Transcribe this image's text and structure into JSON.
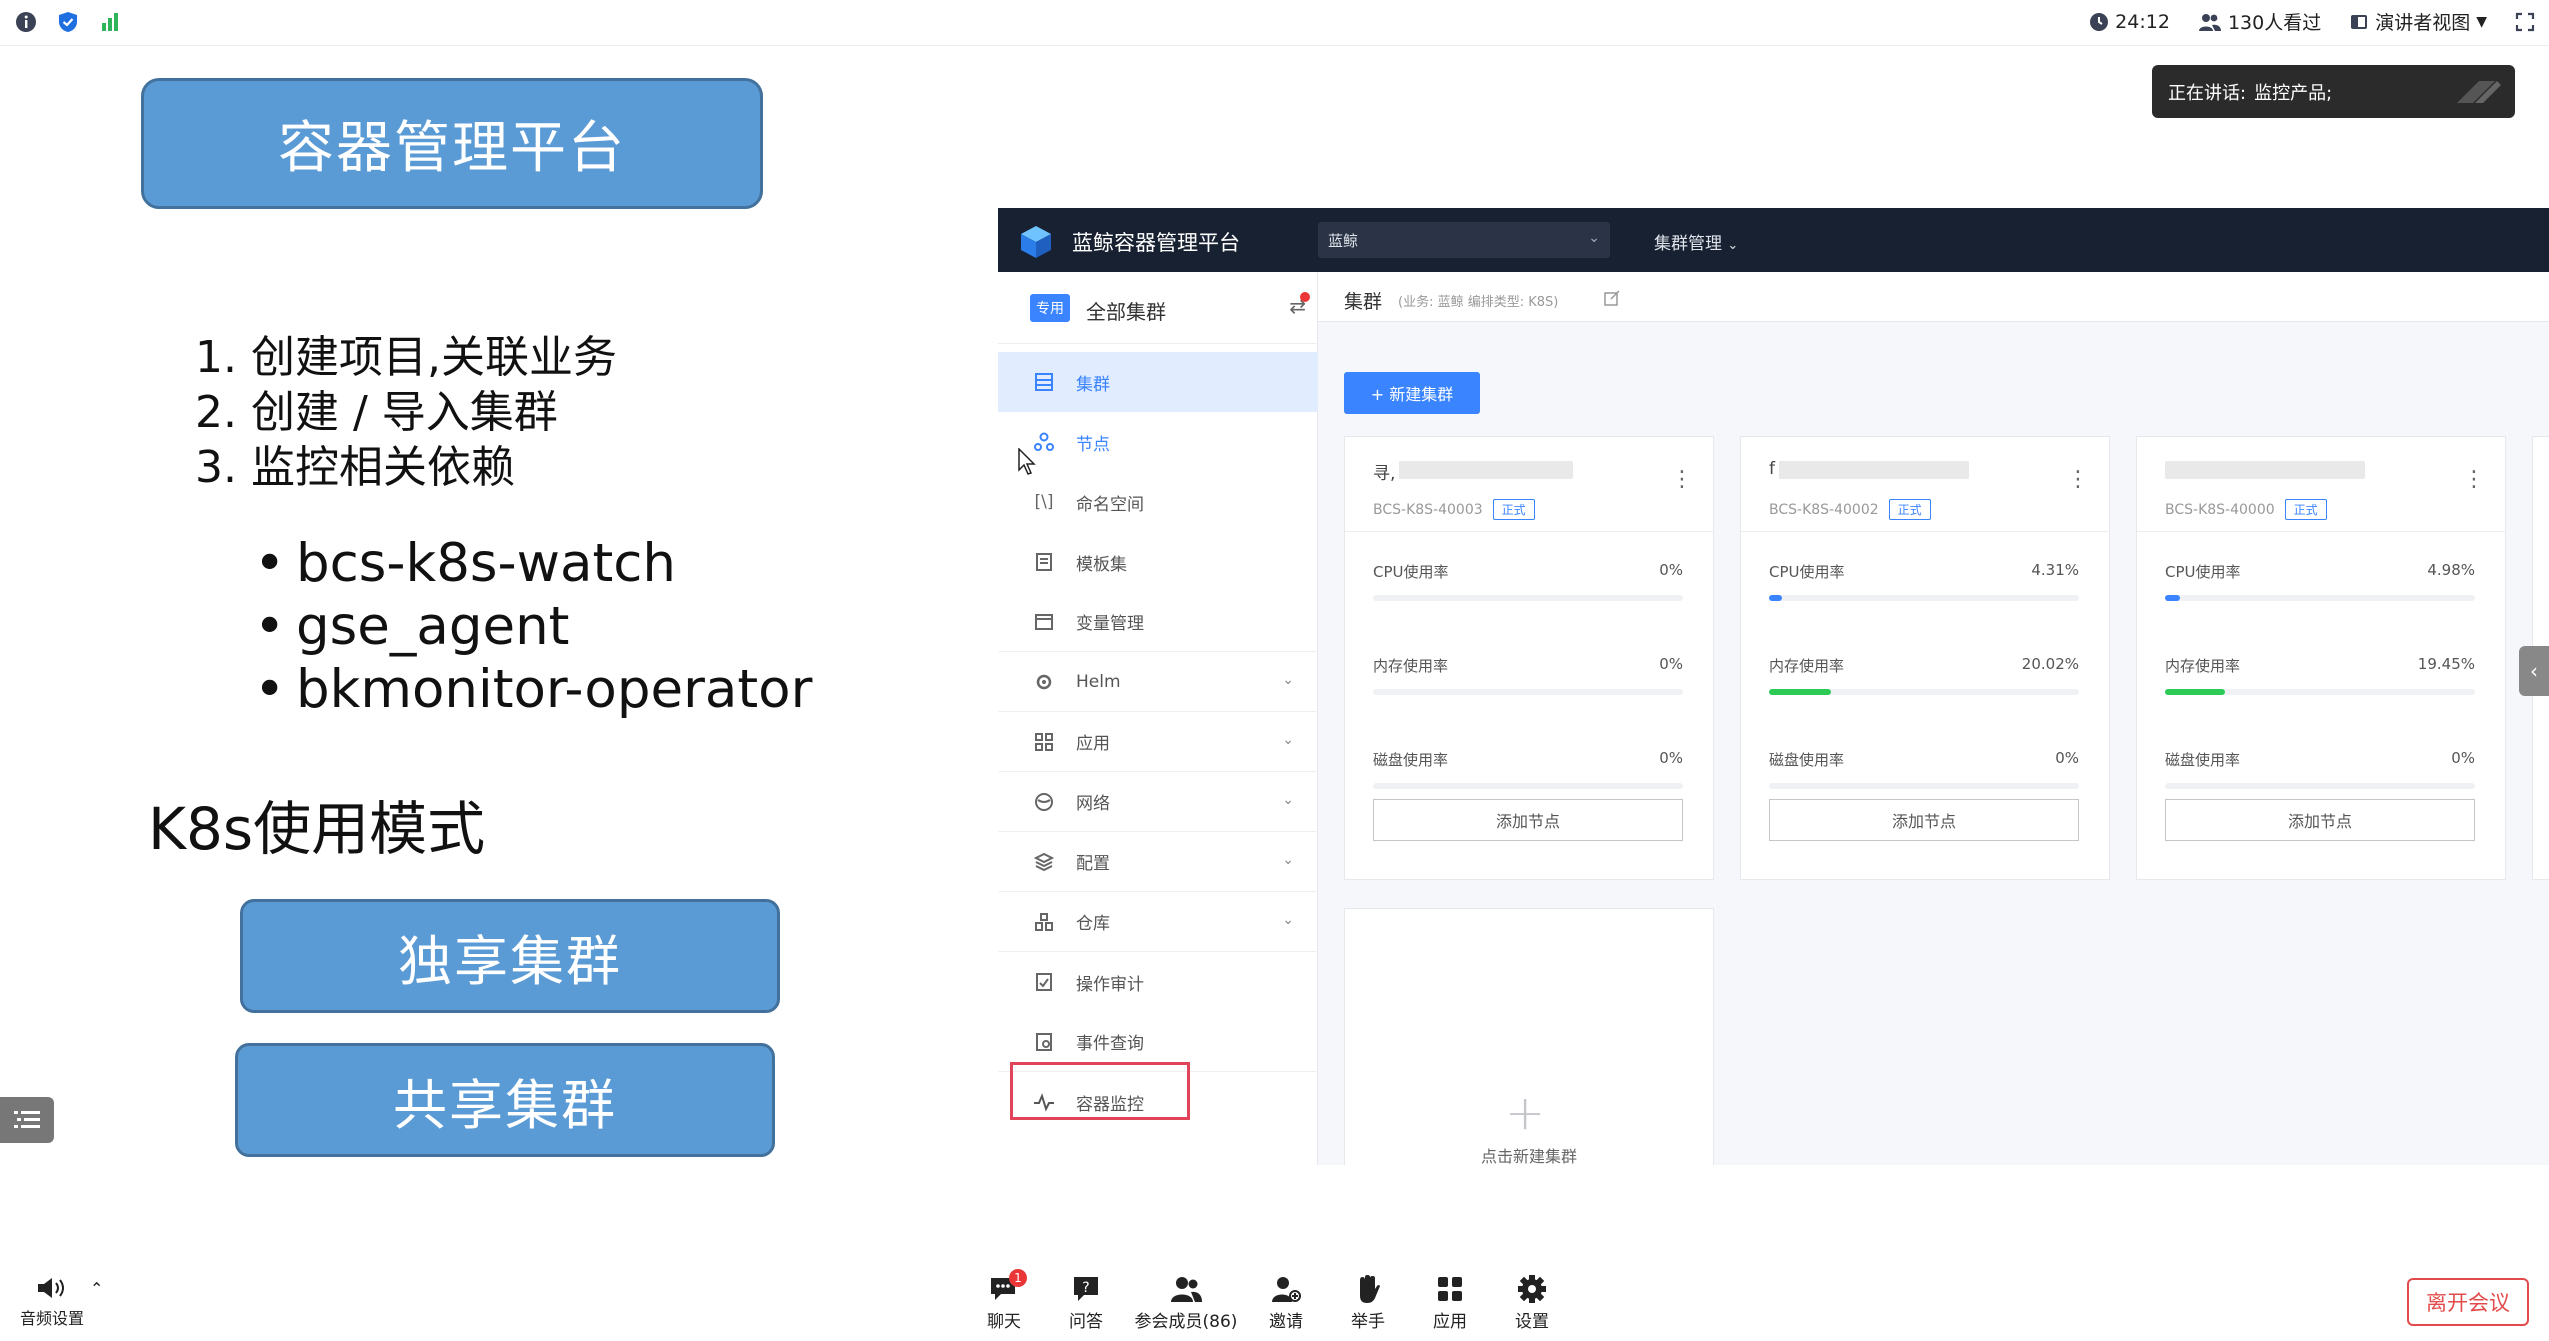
{
  "topbar": {
    "timer": "24:12",
    "viewers": "130人看过",
    "view_mode": "演讲者视图"
  },
  "speaking": {
    "label": "正在讲话:",
    "name": "监控产品;"
  },
  "slide": {
    "title": "容器管理平台",
    "steps": [
      "1. 创建项目,关联业务",
      "2. 创建 / 导入集群",
      "3. 监控相关依赖"
    ],
    "bullets": [
      "bcs-k8s-watch",
      "gse_agent",
      "bkmonitor-operator"
    ],
    "k8s_heading": "K8s使用模式",
    "mode_exclusive": "独享集群",
    "mode_shared": "共享集群"
  },
  "app": {
    "name": "蓝鲸容器管理平台",
    "project_select": "蓝鲸",
    "cluster_mgmt": "集群管理",
    "sidebar": {
      "badge": "专用",
      "all_clusters": "全部集群",
      "items": [
        {
          "label": "集群",
          "icon": "cluster-icon"
        },
        {
          "label": "节点",
          "icon": "node-icon"
        },
        {
          "label": "命名空间",
          "icon": "namespace-icon"
        },
        {
          "label": "模板集",
          "icon": "template-icon"
        },
        {
          "label": "变量管理",
          "icon": "variable-icon"
        },
        {
          "label": "Helm",
          "icon": "helm-icon"
        },
        {
          "label": "应用",
          "icon": "app-icon"
        },
        {
          "label": "网络",
          "icon": "network-icon"
        },
        {
          "label": "配置",
          "icon": "config-icon"
        },
        {
          "label": "仓库",
          "icon": "repo-icon"
        },
        {
          "label": "操作审计",
          "icon": "audit-icon"
        },
        {
          "label": "事件查询",
          "icon": "event-icon"
        },
        {
          "label": "容器监控",
          "icon": "monitor-icon"
        }
      ]
    },
    "breadcrumb": {
      "title": "集群",
      "sub": "(业务: 蓝鲸   编排类型: K8S)"
    },
    "new_cluster_button": "+ 新建集群",
    "cards": [
      {
        "name": "寻,",
        "id": "BCS-K8S-40003",
        "tag": "正式",
        "cpu_label": "CPU使用率",
        "cpu": "0%",
        "cpu_frac": 0,
        "mem_label": "内存使用率",
        "mem": "0%",
        "mem_frac": 0,
        "disk_label": "磁盘使用率",
        "disk": "0%",
        "disk_frac": 0,
        "add": "添加节点"
      },
      {
        "name": "f",
        "id": "BCS-K8S-40002",
        "tag": "正式",
        "cpu_label": "CPU使用率",
        "cpu": "4.31%",
        "cpu_frac": 0.0431,
        "mem_label": "内存使用率",
        "mem": "20.02%",
        "mem_frac": 0.2002,
        "disk_label": "磁盘使用率",
        "disk": "0%",
        "disk_frac": 0,
        "add": "添加节点"
      },
      {
        "name": "",
        "id": "BCS-K8S-40000",
        "tag": "正式",
        "cpu_label": "CPU使用率",
        "cpu": "4.98%",
        "cpu_frac": 0.0498,
        "mem_label": "内存使用率",
        "mem": "19.45%",
        "mem_frac": 0.1945,
        "disk_label": "磁盘使用率",
        "disk": "0%",
        "disk_frac": 0,
        "add": "添加节点"
      }
    ],
    "new_card_label": "点击新建集群"
  },
  "bottombar": {
    "audio": "音频设置",
    "tools": [
      {
        "label": "聊天",
        "icon": "chat-icon",
        "badge": "1"
      },
      {
        "label": "问答",
        "icon": "qa-icon"
      },
      {
        "label": "参会成员(86)",
        "icon": "members-icon"
      },
      {
        "label": "邀请",
        "icon": "invite-icon"
      },
      {
        "label": "举手",
        "icon": "raise-hand-icon"
      },
      {
        "label": "应用",
        "icon": "apps-icon"
      },
      {
        "label": "设置",
        "icon": "settings-icon"
      }
    ],
    "leave": "离开会议"
  },
  "colors": {
    "slide_box": "#5b9bd5",
    "app_header": "#182132",
    "primary": "#3a84ff",
    "highlight": "#e0435a",
    "leave": "#e24b4b"
  }
}
